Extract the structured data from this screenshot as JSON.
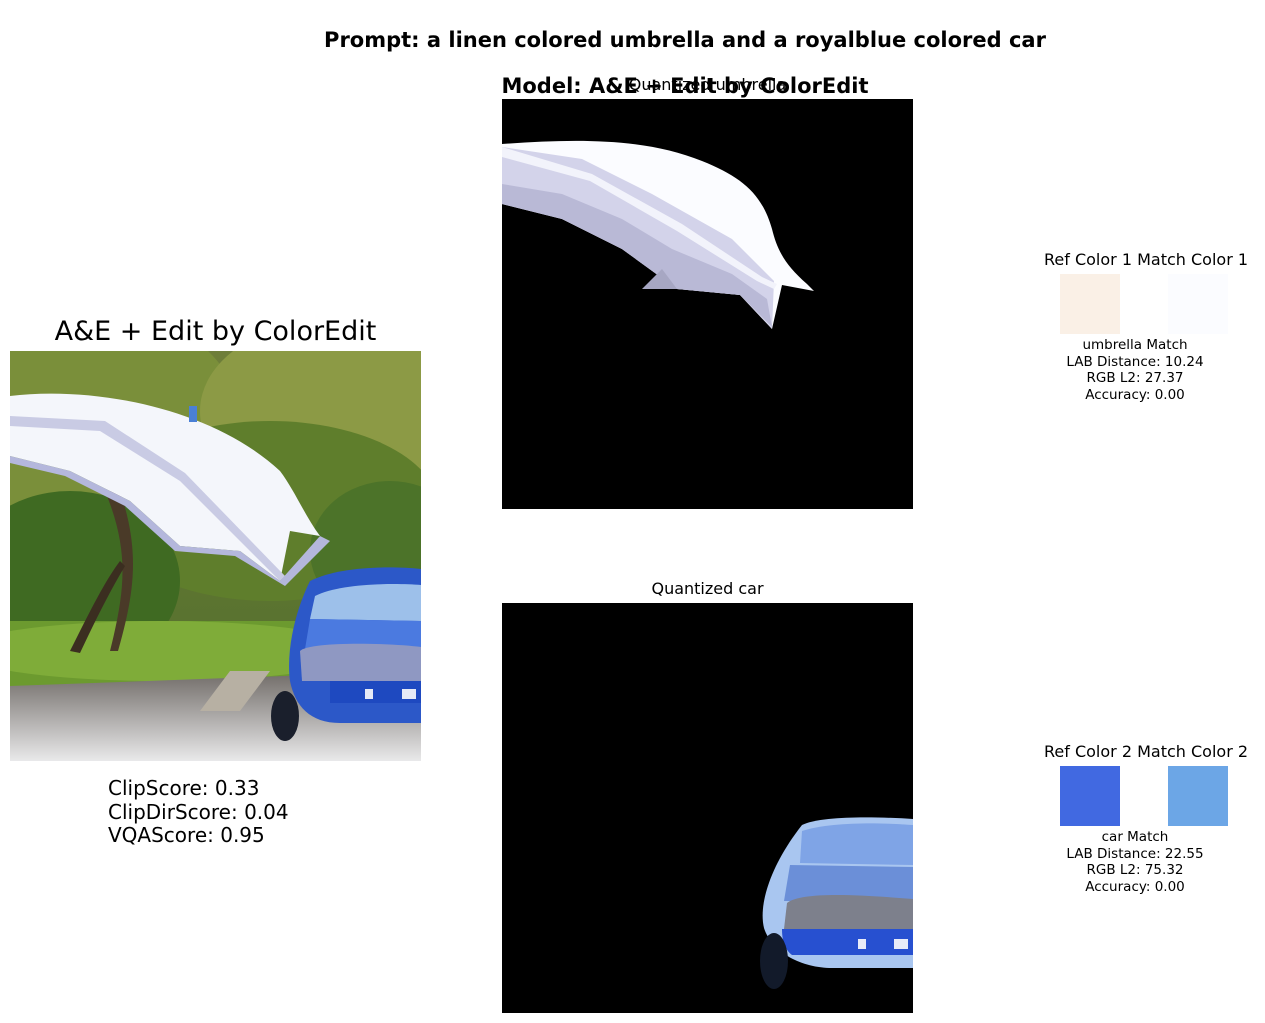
{
  "header": {
    "prompt": "Prompt: a linen colored umbrella and a royalblue colored car",
    "model": "Model: A&E + Edit by ColorEdit"
  },
  "left": {
    "title": "A&E + Edit by ColorEdit",
    "image_description": "white umbrella over blue vintage car on a tree-lined road",
    "scores": [
      "ClipScore: 0.33",
      "ClipDirScore: 0.04",
      "VQAScore: 0.95"
    ]
  },
  "panels": [
    {
      "title": "Quantized umbrella"
    },
    {
      "title": "Quantized car"
    }
  ],
  "color_matches": [
    {
      "ref_label": "Ref Color 1",
      "match_label": "Match Color 1",
      "ref_color": "#FAF0E6",
      "match_color": "#FBFCFF",
      "lines": [
        "umbrella Match",
        "LAB Distance: 10.24",
        "RGB L2: 27.37",
        "Accuracy: 0.00"
      ]
    },
    {
      "ref_label": "Ref Color 2",
      "match_label": "Match Color 2",
      "ref_color": "#4169E1",
      "match_color": "#6CA6E6",
      "lines": [
        "car Match",
        "LAB Distance: 22.55",
        "RGB L2: 75.32",
        "Accuracy: 0.00"
      ]
    }
  ]
}
